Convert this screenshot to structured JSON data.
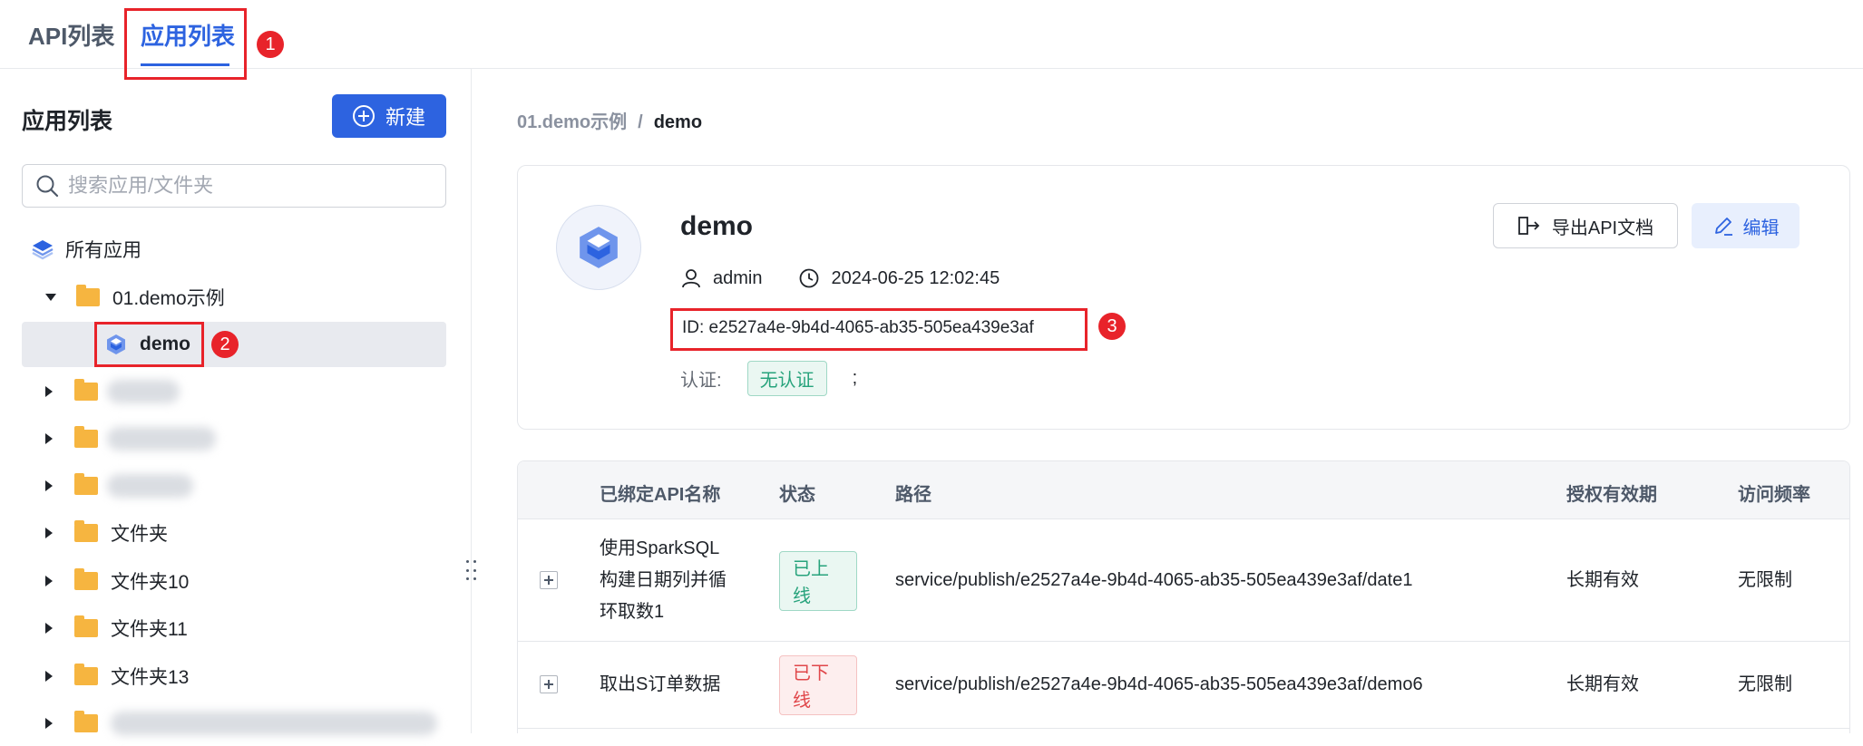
{
  "tabs": [
    {
      "label": "API列表"
    },
    {
      "label": "应用列表"
    }
  ],
  "annotations": [
    "1",
    "2",
    "3"
  ],
  "sidebar": {
    "title": "应用列表",
    "new_label": "新建",
    "search_placeholder": "搜索应用/文件夹",
    "all_apps": "所有应用",
    "tree": {
      "group": "01.demo示例",
      "selected_app": "demo",
      "folders": [
        "文件夹",
        "文件夹10",
        "文件夹11",
        "文件夹13"
      ]
    }
  },
  "breadcrumb": {
    "parent": "01.demo示例",
    "separator": "/",
    "current": "demo"
  },
  "app": {
    "name": "demo",
    "owner": "admin",
    "created": "2024-06-25 12:02:45",
    "id_line": "ID: e2527a4e-9b4d-4065-ab35-505ea439e3af",
    "auth_label": "认证:",
    "auth_value": "无认证",
    "auth_suffix": ";",
    "export_label": "导出API文档",
    "edit_label": "编辑"
  },
  "table": {
    "columns": [
      "已绑定API名称",
      "状态",
      "路径",
      "授权有效期",
      "访问频率"
    ],
    "rows": [
      {
        "name_lines": [
          "使用SparkSQL",
          "构建日期列并循",
          "环取数1"
        ],
        "status_lines": [
          "已上",
          "线"
        ],
        "path": "service/publish/e2527a4e-9b4d-4065-ab35-505ea439e3af/date1",
        "validity": "长期有效",
        "rate": "无限制"
      },
      {
        "name_lines": [
          "取出S订单数据"
        ],
        "status_lines": [
          "已下",
          "线"
        ],
        "path": "service/publish/e2527a4e-9b4d-4065-ab35-505ea439e3af/demo6",
        "validity": "长期有效",
        "rate": "无限制"
      }
    ]
  },
  "colors": {
    "primary": "#2d63e0",
    "annotation": "#e8232a",
    "online": "#27a37c",
    "offline": "#e0474a",
    "folder": "#f6b540"
  }
}
